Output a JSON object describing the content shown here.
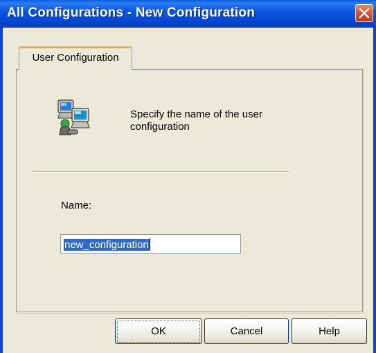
{
  "window": {
    "title": "All Configurations - New Configuration"
  },
  "tabs": [
    {
      "label": "User Configuration",
      "selected": true
    }
  ],
  "content": {
    "description": "Specify the name of the user configuration",
    "icon": "network-computers-icon",
    "name_label": "Name:",
    "name_value": "new_configuration"
  },
  "buttons": {
    "ok": "OK",
    "cancel": "Cancel",
    "help": "Help"
  },
  "colors": {
    "titlebar": "#0346d2",
    "dialog_bg": "#ece9d8",
    "selection": "#316ac5",
    "close_button": "#d1542f",
    "tab_highlight": "#f2ac3a"
  }
}
